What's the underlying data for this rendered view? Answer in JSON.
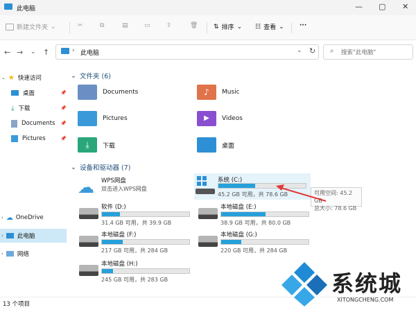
{
  "window": {
    "title": "此电脑",
    "minimize": "—",
    "maximize": "▢",
    "close": "✕"
  },
  "toolbar": {
    "new_folder": "新建文件夹",
    "sort": "排序",
    "view": "查看",
    "more": "···"
  },
  "address": {
    "path": "此电脑",
    "search_placeholder": "搜索\"此电脑\""
  },
  "sidebar": {
    "quick_access": "快速访问",
    "items": [
      {
        "label": "桌面",
        "pinned": true
      },
      {
        "label": "下载",
        "pinned": true
      },
      {
        "label": "Documents",
        "pinned": true
      },
      {
        "label": "Pictures",
        "pinned": true
      }
    ],
    "onedrive": "OneDrive",
    "this_pc": "此电脑",
    "network": "网络"
  },
  "folders_section": {
    "title": "文件夹 (6)"
  },
  "folders": [
    {
      "label": "Documents",
      "color": "#6b8fc4"
    },
    {
      "label": "Music",
      "color": "#e0734a"
    },
    {
      "label": "Pictures",
      "color": "#3a9ad9"
    },
    {
      "label": "Videos",
      "color": "#8a4fd0"
    },
    {
      "label": "下载",
      "color": "#2aa67a"
    },
    {
      "label": "桌面",
      "color": "#2d8fd5"
    }
  ],
  "drives_section": {
    "title": "设备和驱动器 (7)"
  },
  "wps": {
    "name": "WPS网盘",
    "subtitle": "双击进入WPS网盘"
  },
  "drives": [
    {
      "name": "系统 (C:)",
      "capacity": "45.2 GB 可用，共 78.6 GB",
      "used_fraction": 0.42
    },
    {
      "name": "软件 (D:)",
      "capacity": "31.4 GB 可用，共 39.9 GB",
      "used_fraction": 0.21
    },
    {
      "name": "本地磁盘 (E:)",
      "capacity": "38.9 GB 可用，共 80.0 GB",
      "used_fraction": 0.51
    },
    {
      "name": "本地磁盘 (F:)",
      "capacity": "217 GB 可用，共 284 GB",
      "used_fraction": 0.24
    },
    {
      "name": "本地磁盘 (G:)",
      "capacity": "220 GB 可用，共 284 GB",
      "used_fraction": 0.23
    },
    {
      "name": "本地磁盘 (H:)",
      "capacity": "245 GB 可用，共 283 GB",
      "used_fraction": 0.13
    }
  ],
  "tooltip": {
    "line1": "可用空间: 45.2 GB",
    "line2": "总大小: 78.6 GB"
  },
  "status": {
    "items": "13 个项目"
  },
  "watermark": {
    "brand": "系统城",
    "url": "XITONGCHENG.COM"
  },
  "colors": {
    "accent": "#26a0da",
    "selected": "#cde8f6",
    "arrow": "#e03a3a"
  }
}
